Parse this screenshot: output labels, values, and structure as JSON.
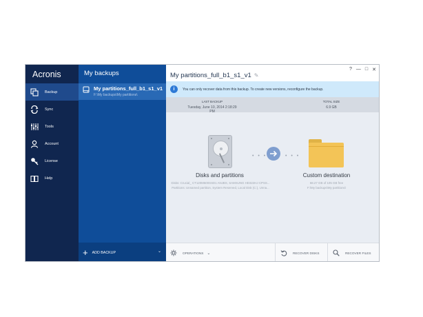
{
  "nav": {
    "brand": "Acronis",
    "items": [
      {
        "label": "Backup",
        "icon": "copy-icon"
      },
      {
        "label": "Sync",
        "icon": "sync-icon"
      },
      {
        "label": "Tools",
        "icon": "sliders-icon"
      },
      {
        "label": "Account",
        "icon": "person-icon"
      },
      {
        "label": "License",
        "icon": "key-icon"
      },
      {
        "label": "Help",
        "icon": "book-icon"
      }
    ]
  },
  "list": {
    "header": "My backups",
    "backup": {
      "name": "My partitions_full_b1_s1_v1",
      "path": "F:\\My backups\\My partitions\\"
    },
    "add_backup": "ADD BACKUP"
  },
  "main": {
    "title": "My partitions_full_b1_s1_v1",
    "window_controls": [
      "?",
      "—",
      "□",
      "✕"
    ],
    "banner": "You can only recover data from this backup. To create new versions, reconfigure the backup.",
    "last_backup_label": "LAST BACKUP",
    "last_backup_value": "Tuesday, June 10, 2014 2:18:29 PM",
    "total_size_label": "TOTAL SIZE",
    "total_size_value": "6.9 GB",
    "source_title": "Disks and partitions",
    "source_line1": "Disks: Crucial_ CT120M500SSD1 ANJBS, SAMSUNG HD322HJ CPSS...",
    "source_line2": "Partitions: Unnamed partition, System Reserved, Local Disk (C:), Unna...",
    "dest_title": "Custom destination",
    "dest_line1": "68.27 GB of 105 GB free",
    "dest_line2": "F:\\My backups\\My partitions\\",
    "operations": "OPERATIONS",
    "recover_disks": "RECOVER DISKS",
    "recover_files": "RECOVER FILES"
  },
  "colors": {
    "nav_bg": "#10264f",
    "list_bg": "#0f4d99",
    "selected_item": "#2969b5",
    "accent": "#2e7ad6",
    "folder": "#f3c457"
  }
}
